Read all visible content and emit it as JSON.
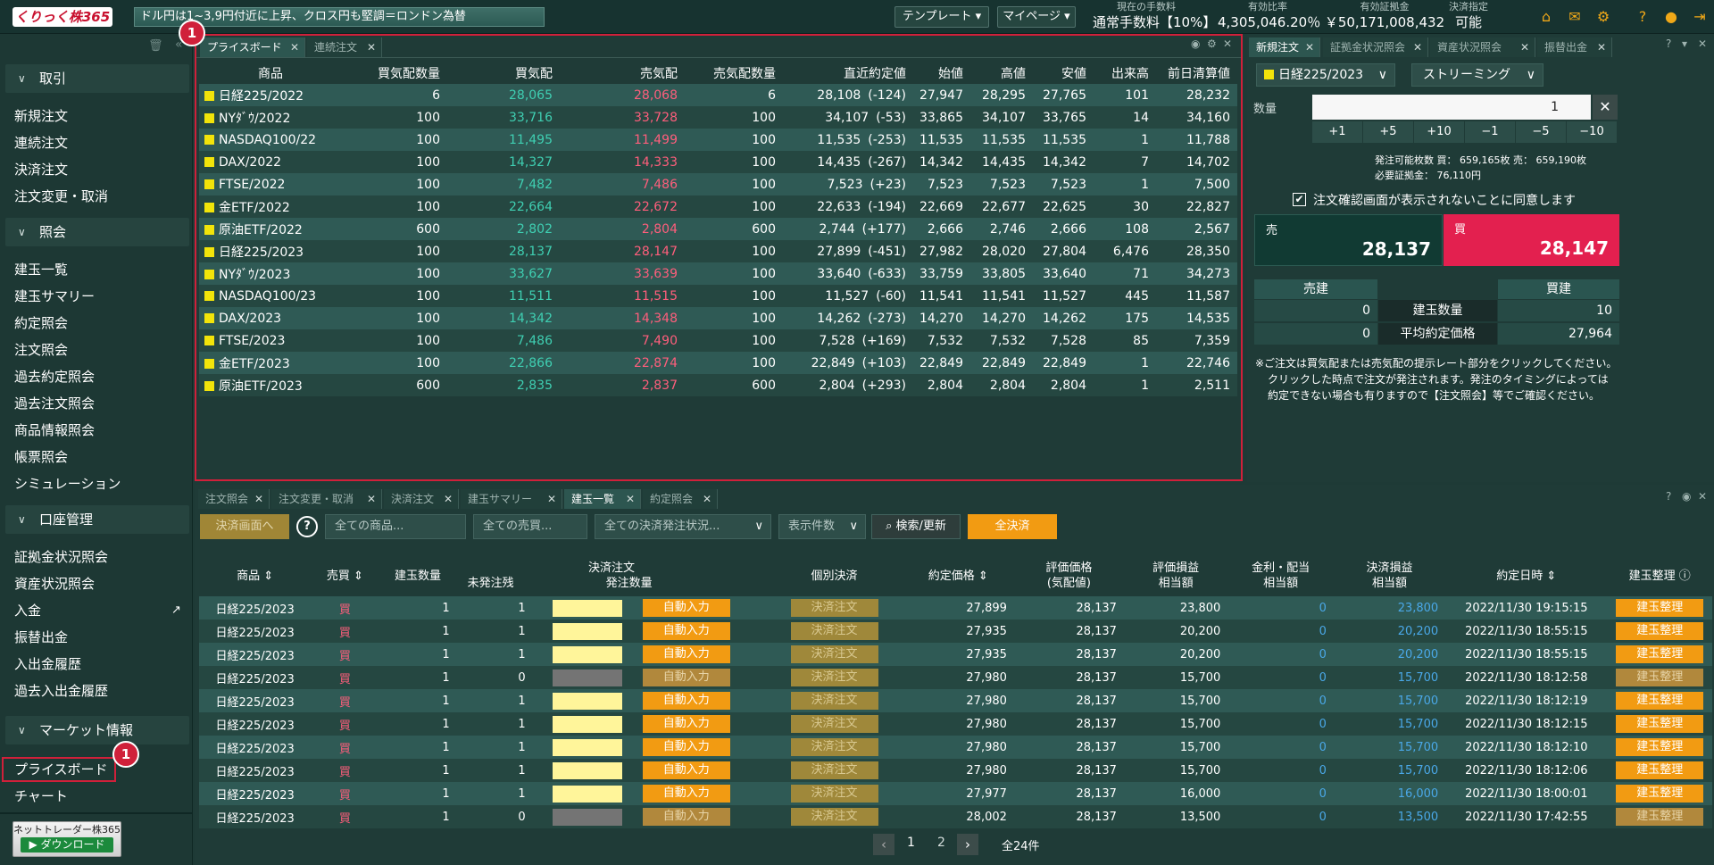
{
  "header": {
    "logo": "くりっく株365",
    "ticker": "ドル円は1~3,9円付近に上昇、クロス円も堅調＝ロンドン為替",
    "template_label": "テンプレート",
    "mypage_label": "マイページ",
    "fee_label": "現在の手数料",
    "fee_value": "通常手数料【10%】",
    "margin_ratio_label": "有効比率",
    "margin_ratio_value": "4,305,046.20％",
    "effective_margin_label": "有効証拠金",
    "effective_margin_value": "￥50,171,008,432",
    "settlement_label": "決済指定",
    "settlement_value": "可能"
  },
  "sidebar": {
    "sections": [
      {
        "title": "取引",
        "items": [
          "新規注文",
          "連続注文",
          "決済注文",
          "注文変更・取消"
        ]
      },
      {
        "title": "照会",
        "items": [
          "建玉一覧",
          "建玉サマリー",
          "約定照会",
          "注文照会",
          "過去約定照会",
          "過去注文照会",
          "商品情報照会",
          "帳票照会",
          "シミュレーション"
        ]
      },
      {
        "title": "口座管理",
        "items": [
          "証拠金状況照会",
          "資産状況照会",
          "入金",
          "振替出金",
          "入出金履歴",
          "過去入出金履歴"
        ]
      },
      {
        "title": "マーケット情報",
        "items": [
          "プライスボード",
          "チャート"
        ]
      }
    ],
    "download_top": "ネットトレーダー株365",
    "download_bottom": "ダウンロード",
    "badge": "1"
  },
  "priceboard": {
    "tabs": [
      "プライスボード",
      "連続注文"
    ],
    "headers": [
      "商品",
      "買気配数量",
      "買気配",
      "売気配",
      "売気配数量",
      "直近約定値",
      "始値",
      "高値",
      "安値",
      "出来高",
      "前日清算値"
    ],
    "rows": [
      [
        "日経225/2022",
        "6",
        "28,065",
        "28,068",
        "6",
        "28,108",
        "(-124)",
        "27,947",
        "28,295",
        "27,765",
        "101",
        "28,232"
      ],
      [
        "NYﾀﾞｳ/2022",
        "100",
        "33,716",
        "33,728",
        "100",
        "34,107",
        "(-53)",
        "33,865",
        "34,107",
        "33,765",
        "14",
        "34,160"
      ],
      [
        "NASDAQ100/22",
        "100",
        "11,495",
        "11,499",
        "100",
        "11,535",
        "(-253)",
        "11,535",
        "11,535",
        "11,535",
        "1",
        "11,788"
      ],
      [
        "DAX/2022",
        "100",
        "14,327",
        "14,333",
        "100",
        "14,435",
        "(-267)",
        "14,342",
        "14,435",
        "14,342",
        "7",
        "14,702"
      ],
      [
        "FTSE/2022",
        "100",
        "7,482",
        "7,486",
        "100",
        "7,523",
        "(+23)",
        "7,523",
        "7,523",
        "7,523",
        "1",
        "7,500"
      ],
      [
        "金ETF/2022",
        "100",
        "22,664",
        "22,672",
        "100",
        "22,633",
        "(-194)",
        "22,669",
        "22,677",
        "22,625",
        "30",
        "22,827"
      ],
      [
        "原油ETF/2022",
        "600",
        "2,802",
        "2,804",
        "600",
        "2,744",
        "(+177)",
        "2,666",
        "2,746",
        "2,666",
        "108",
        "2,567"
      ],
      [
        "日経225/2023",
        "100",
        "28,137",
        "28,147",
        "100",
        "27,899",
        "(-451)",
        "27,982",
        "28,020",
        "27,804",
        "6,476",
        "28,350"
      ],
      [
        "NYﾀﾞｳ/2023",
        "100",
        "33,627",
        "33,639",
        "100",
        "33,640",
        "(-633)",
        "33,759",
        "33,805",
        "33,640",
        "71",
        "34,273"
      ],
      [
        "NASDAQ100/23",
        "100",
        "11,511",
        "11,515",
        "100",
        "11,527",
        "(-60)",
        "11,541",
        "11,541",
        "11,527",
        "445",
        "11,587"
      ],
      [
        "DAX/2023",
        "100",
        "14,342",
        "14,348",
        "100",
        "14,262",
        "(-273)",
        "14,270",
        "14,270",
        "14,262",
        "175",
        "14,535"
      ],
      [
        "FTSE/2023",
        "100",
        "7,486",
        "7,490",
        "100",
        "7,528",
        "(+169)",
        "7,532",
        "7,532",
        "7,528",
        "85",
        "7,359"
      ],
      [
        "金ETF/2023",
        "100",
        "22,866",
        "22,874",
        "100",
        "22,849",
        "(+103)",
        "22,849",
        "22,849",
        "22,849",
        "1",
        "22,746"
      ],
      [
        "原油ETF/2023",
        "600",
        "2,835",
        "2,837",
        "600",
        "2,804",
        "(+293)",
        "2,804",
        "2,804",
        "2,804",
        "1",
        "2,511"
      ]
    ]
  },
  "order": {
    "tabs": [
      "新規注文",
      "証拠金状況照会",
      "資産状況照会",
      "振替出金"
    ],
    "product": "日経225/2023",
    "mode": "ストリーミング",
    "qty_label": "数量",
    "qty_value": "1",
    "steps": [
      "+1",
      "+5",
      "+10",
      "−1",
      "−5",
      "−10"
    ],
    "avail": "発注可能枚数 買： 659,165枚 売： 659,190枚",
    "req_margin": "必要証拠金： 76,110円",
    "confirm_text": "注文確認画面が表示されないことに同意します",
    "sell_label": "売",
    "sell_price": "28,137",
    "buy_label": "買",
    "buy_price": "28,147",
    "pos_sell_label": "売建",
    "pos_buy_label": "買建",
    "pos_qty_label": "建玉数量",
    "pos_avg_label": "平均約定価格",
    "pos_sell_qty": "0",
    "pos_buy_qty": "10",
    "pos_sell_avg": "0",
    "pos_buy_avg": "27,964",
    "note1": "※ご注文は買気配または売気配の提示レート部分をクリックしてください。",
    "note2": "クリックした時点で注文が発注されます。発注のタイミングによっては",
    "note3": "約定できない場合も有りますので【注文照会】等でご確認ください。"
  },
  "positions": {
    "tabs": [
      "注文照会",
      "注文変更・取消",
      "決済注文",
      "建玉サマリー",
      "建玉一覧",
      "約定照会"
    ],
    "settle_screen": "決済画面へ",
    "filter_product": "全ての商品...",
    "filter_side": "全ての売買...",
    "filter_status": "全ての決済発注状況...",
    "filter_count": "表示件数",
    "search_label": "検索/更新",
    "all_settle": "全決済",
    "headers": [
      "商品",
      "売買",
      "建玉数量",
      "決済注文",
      "未発注残",
      "発注数量",
      "個別決済",
      "約定価格",
      "評価価格",
      "(気配値)",
      "評価損益",
      "相当額",
      "金利・配当",
      "相当額",
      "決済損益",
      "相当額",
      "約定日時",
      "建玉整理"
    ],
    "auto_label": "自動入力",
    "settle_label": "決済注文",
    "manage_label": "建玉整理",
    "rows": [
      [
        "日経225/2023",
        "買",
        "1",
        "1",
        "27,899",
        "28,137",
        "23,800",
        "0",
        "23,800",
        "2022/11/30 19:15:15"
      ],
      [
        "日経225/2023",
        "買",
        "1",
        "1",
        "27,935",
        "28,137",
        "20,200",
        "0",
        "20,200",
        "2022/11/30 18:55:15"
      ],
      [
        "日経225/2023",
        "買",
        "1",
        "1",
        "27,935",
        "28,137",
        "20,200",
        "0",
        "20,200",
        "2022/11/30 18:55:15"
      ],
      [
        "日経225/2023",
        "買",
        "1",
        "0",
        "27,980",
        "28,137",
        "15,700",
        "0",
        "15,700",
        "2022/11/30 18:12:58"
      ],
      [
        "日経225/2023",
        "買",
        "1",
        "1",
        "27,980",
        "28,137",
        "15,700",
        "0",
        "15,700",
        "2022/11/30 18:12:19"
      ],
      [
        "日経225/2023",
        "買",
        "1",
        "1",
        "27,980",
        "28,137",
        "15,700",
        "0",
        "15,700",
        "2022/11/30 18:12:15"
      ],
      [
        "日経225/2023",
        "買",
        "1",
        "1",
        "27,980",
        "28,137",
        "15,700",
        "0",
        "15,700",
        "2022/11/30 18:12:10"
      ],
      [
        "日経225/2023",
        "買",
        "1",
        "1",
        "27,980",
        "28,137",
        "15,700",
        "0",
        "15,700",
        "2022/11/30 18:12:06"
      ],
      [
        "日経225/2023",
        "買",
        "1",
        "1",
        "27,977",
        "28,137",
        "16,000",
        "0",
        "16,000",
        "2022/11/30 18:00:01"
      ],
      [
        "日経225/2023",
        "買",
        "1",
        "0",
        "28,002",
        "28,137",
        "13,500",
        "0",
        "13,500",
        "2022/11/30 17:42:55"
      ]
    ],
    "pages": [
      "1",
      "2"
    ],
    "total": "全24件"
  },
  "colors": {
    "bid": "#3fcfb2",
    "ask": "#ff5e7c",
    "accent": "#f29b12",
    "highlight": "#d0203a"
  }
}
